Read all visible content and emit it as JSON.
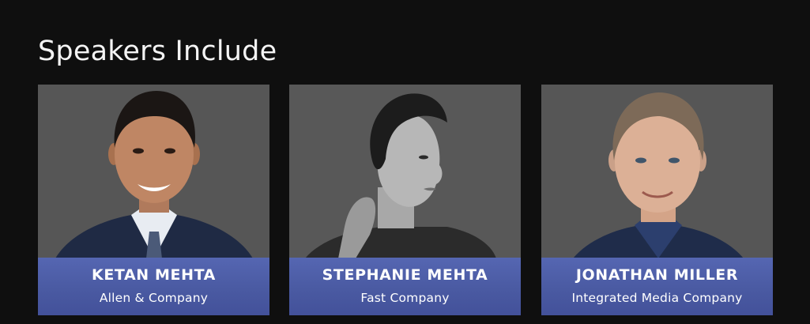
{
  "section": {
    "title": "Speakers Include"
  },
  "speakers": [
    {
      "name": "KETAN MEHTA",
      "company": "Allen & Company"
    },
    {
      "name": "STEPHANIE MEHTA",
      "company": "Fast Company"
    },
    {
      "name": "JONATHAN MILLER",
      "company": "Integrated Media Company"
    }
  ],
  "colors": {
    "page_background": "#0f0f0f",
    "card_background": "#565656",
    "caption_accent": "#4a5aa2",
    "text": "#ffffff"
  }
}
